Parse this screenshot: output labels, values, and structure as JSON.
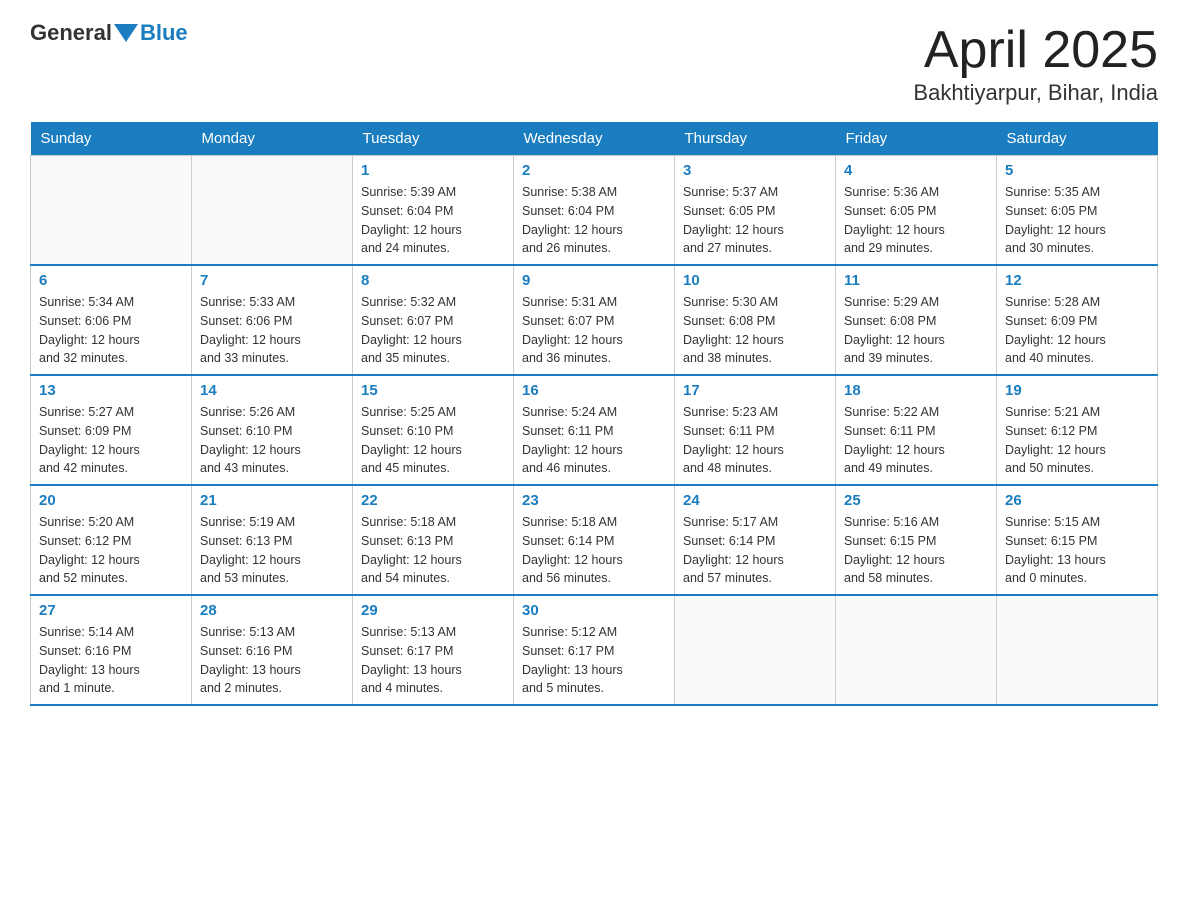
{
  "header": {
    "logo_general": "General",
    "logo_blue": "Blue",
    "title": "April 2025",
    "location": "Bakhtiyarpur, Bihar, India"
  },
  "weekdays": [
    "Sunday",
    "Monday",
    "Tuesday",
    "Wednesday",
    "Thursday",
    "Friday",
    "Saturday"
  ],
  "weeks": [
    [
      {
        "day": "",
        "info": ""
      },
      {
        "day": "",
        "info": ""
      },
      {
        "day": "1",
        "info": "Sunrise: 5:39 AM\nSunset: 6:04 PM\nDaylight: 12 hours\nand 24 minutes."
      },
      {
        "day": "2",
        "info": "Sunrise: 5:38 AM\nSunset: 6:04 PM\nDaylight: 12 hours\nand 26 minutes."
      },
      {
        "day": "3",
        "info": "Sunrise: 5:37 AM\nSunset: 6:05 PM\nDaylight: 12 hours\nand 27 minutes."
      },
      {
        "day": "4",
        "info": "Sunrise: 5:36 AM\nSunset: 6:05 PM\nDaylight: 12 hours\nand 29 minutes."
      },
      {
        "day": "5",
        "info": "Sunrise: 5:35 AM\nSunset: 6:05 PM\nDaylight: 12 hours\nand 30 minutes."
      }
    ],
    [
      {
        "day": "6",
        "info": "Sunrise: 5:34 AM\nSunset: 6:06 PM\nDaylight: 12 hours\nand 32 minutes."
      },
      {
        "day": "7",
        "info": "Sunrise: 5:33 AM\nSunset: 6:06 PM\nDaylight: 12 hours\nand 33 minutes."
      },
      {
        "day": "8",
        "info": "Sunrise: 5:32 AM\nSunset: 6:07 PM\nDaylight: 12 hours\nand 35 minutes."
      },
      {
        "day": "9",
        "info": "Sunrise: 5:31 AM\nSunset: 6:07 PM\nDaylight: 12 hours\nand 36 minutes."
      },
      {
        "day": "10",
        "info": "Sunrise: 5:30 AM\nSunset: 6:08 PM\nDaylight: 12 hours\nand 38 minutes."
      },
      {
        "day": "11",
        "info": "Sunrise: 5:29 AM\nSunset: 6:08 PM\nDaylight: 12 hours\nand 39 minutes."
      },
      {
        "day": "12",
        "info": "Sunrise: 5:28 AM\nSunset: 6:09 PM\nDaylight: 12 hours\nand 40 minutes."
      }
    ],
    [
      {
        "day": "13",
        "info": "Sunrise: 5:27 AM\nSunset: 6:09 PM\nDaylight: 12 hours\nand 42 minutes."
      },
      {
        "day": "14",
        "info": "Sunrise: 5:26 AM\nSunset: 6:10 PM\nDaylight: 12 hours\nand 43 minutes."
      },
      {
        "day": "15",
        "info": "Sunrise: 5:25 AM\nSunset: 6:10 PM\nDaylight: 12 hours\nand 45 minutes."
      },
      {
        "day": "16",
        "info": "Sunrise: 5:24 AM\nSunset: 6:11 PM\nDaylight: 12 hours\nand 46 minutes."
      },
      {
        "day": "17",
        "info": "Sunrise: 5:23 AM\nSunset: 6:11 PM\nDaylight: 12 hours\nand 48 minutes."
      },
      {
        "day": "18",
        "info": "Sunrise: 5:22 AM\nSunset: 6:11 PM\nDaylight: 12 hours\nand 49 minutes."
      },
      {
        "day": "19",
        "info": "Sunrise: 5:21 AM\nSunset: 6:12 PM\nDaylight: 12 hours\nand 50 minutes."
      }
    ],
    [
      {
        "day": "20",
        "info": "Sunrise: 5:20 AM\nSunset: 6:12 PM\nDaylight: 12 hours\nand 52 minutes."
      },
      {
        "day": "21",
        "info": "Sunrise: 5:19 AM\nSunset: 6:13 PM\nDaylight: 12 hours\nand 53 minutes."
      },
      {
        "day": "22",
        "info": "Sunrise: 5:18 AM\nSunset: 6:13 PM\nDaylight: 12 hours\nand 54 minutes."
      },
      {
        "day": "23",
        "info": "Sunrise: 5:18 AM\nSunset: 6:14 PM\nDaylight: 12 hours\nand 56 minutes."
      },
      {
        "day": "24",
        "info": "Sunrise: 5:17 AM\nSunset: 6:14 PM\nDaylight: 12 hours\nand 57 minutes."
      },
      {
        "day": "25",
        "info": "Sunrise: 5:16 AM\nSunset: 6:15 PM\nDaylight: 12 hours\nand 58 minutes."
      },
      {
        "day": "26",
        "info": "Sunrise: 5:15 AM\nSunset: 6:15 PM\nDaylight: 13 hours\nand 0 minutes."
      }
    ],
    [
      {
        "day": "27",
        "info": "Sunrise: 5:14 AM\nSunset: 6:16 PM\nDaylight: 13 hours\nand 1 minute."
      },
      {
        "day": "28",
        "info": "Sunrise: 5:13 AM\nSunset: 6:16 PM\nDaylight: 13 hours\nand 2 minutes."
      },
      {
        "day": "29",
        "info": "Sunrise: 5:13 AM\nSunset: 6:17 PM\nDaylight: 13 hours\nand 4 minutes."
      },
      {
        "day": "30",
        "info": "Sunrise: 5:12 AM\nSunset: 6:17 PM\nDaylight: 13 hours\nand 5 minutes."
      },
      {
        "day": "",
        "info": ""
      },
      {
        "day": "",
        "info": ""
      },
      {
        "day": "",
        "info": ""
      }
    ]
  ]
}
